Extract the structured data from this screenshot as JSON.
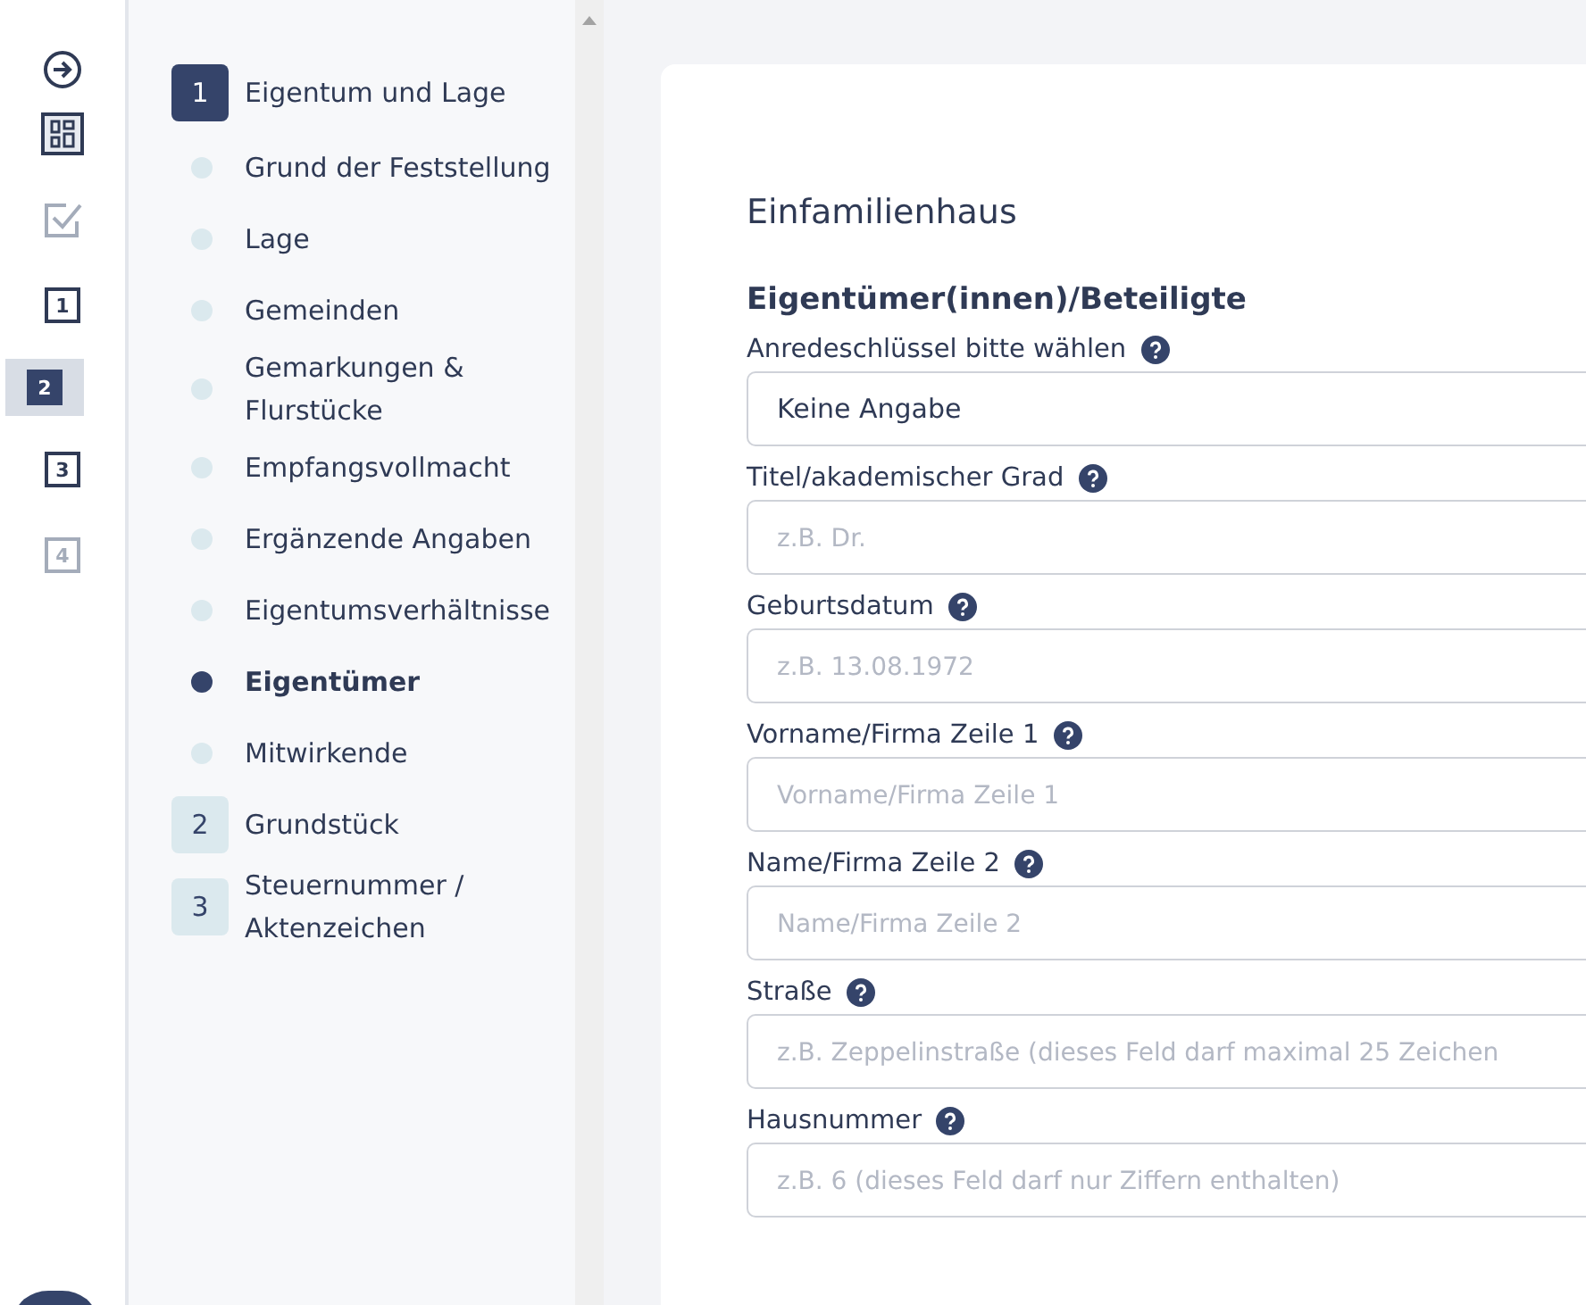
{
  "rail": [
    {
      "kind": "arrow",
      "selected": false,
      "disabled": false
    },
    {
      "kind": "dashboard",
      "selected": false,
      "disabled": false
    },
    {
      "kind": "check",
      "selected": false,
      "disabled": true
    },
    {
      "kind": "step",
      "label": "1",
      "selected": false,
      "disabled": false
    },
    {
      "kind": "step",
      "label": "2",
      "selected": true,
      "disabled": false
    },
    {
      "kind": "step",
      "label": "3",
      "selected": false,
      "disabled": false
    },
    {
      "kind": "step",
      "label": "4",
      "selected": false,
      "disabled": true
    }
  ],
  "sections": [
    {
      "number": "1",
      "title": "Eigentum und Lage",
      "selected": true,
      "children": [
        {
          "label": "Grund der Feststellung",
          "selected": false
        },
        {
          "label": "Lage",
          "selected": false
        },
        {
          "label": "Gemeinden",
          "selected": false
        },
        {
          "label": "Gemarkungen & Flurstücke",
          "selected": false
        },
        {
          "label": "Empfangsvollmacht",
          "selected": false
        },
        {
          "label": "Ergänzende Angaben",
          "selected": false
        },
        {
          "label": "Eigentumsverhältnisse",
          "selected": false
        },
        {
          "label": "Eigentümer",
          "selected": true
        },
        {
          "label": "Mitwirkende",
          "selected": false
        }
      ]
    },
    {
      "number": "2",
      "title": "Grundstück",
      "selected": false
    },
    {
      "number": "3",
      "title": "Steuernummer / Aktenzeichen",
      "selected": false
    }
  ],
  "form": {
    "title": "Einfamilienhaus",
    "heading": "Eigentümer(innen)/Beteiligte",
    "fields": [
      {
        "label": "Anredeschlüssel bitte wählen",
        "value": "Keine Angabe"
      },
      {
        "label": "Titel/akademischer Grad",
        "placeholder": "z.B. Dr."
      },
      {
        "label": "Geburtsdatum",
        "placeholder": "z.B. 13.08.1972"
      },
      {
        "label": "Vorname/Firma Zeile 1",
        "placeholder": "Vorname/Firma Zeile 1"
      },
      {
        "label": "Name/Firma Zeile 2",
        "placeholder": "Name/Firma Zeile 2"
      },
      {
        "label": "Straße",
        "placeholder": "z.B. Zeppelinstraße (dieses Feld darf maximal 25 Zeichen"
      },
      {
        "label": "Hausnummer",
        "placeholder": "z.B. 6 (dieses Feld darf nur Ziffern enthalten)"
      }
    ]
  }
}
